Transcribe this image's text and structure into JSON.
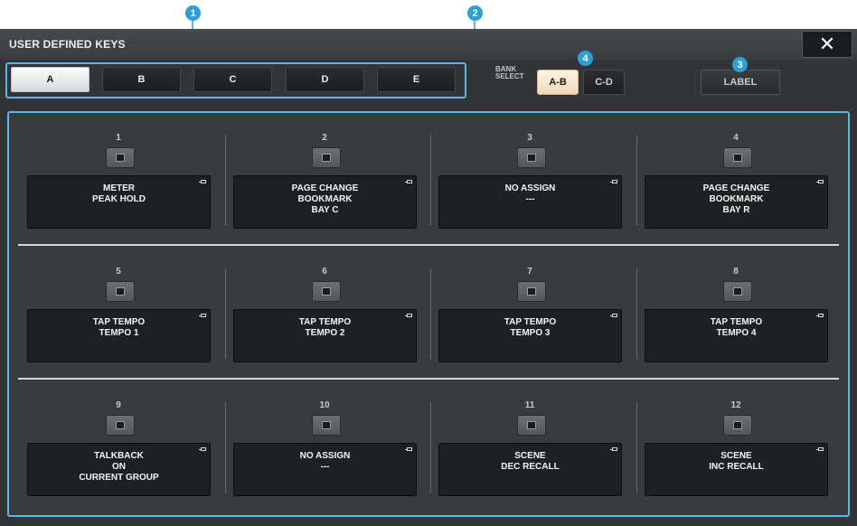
{
  "window": {
    "title": "USER DEFINED KEYS",
    "close_label": "✕"
  },
  "tabs": [
    {
      "label": "A",
      "active": true
    },
    {
      "label": "B",
      "active": false
    },
    {
      "label": "C",
      "active": false
    },
    {
      "label": "D",
      "active": false
    },
    {
      "label": "E",
      "active": false
    }
  ],
  "bank_select": {
    "label_line1": "BANK",
    "label_line2": "SELECT",
    "options": [
      {
        "label": "A-B",
        "active": true
      },
      {
        "label": "C-D",
        "active": false
      }
    ]
  },
  "label_button": "LABEL",
  "callouts": [
    "1",
    "2",
    "3",
    "4"
  ],
  "keys": [
    {
      "number": "1",
      "assignment": "METER\nPEAK HOLD"
    },
    {
      "number": "2",
      "assignment": "PAGE CHANGE\nBOOKMARK\nBAY C"
    },
    {
      "number": "3",
      "assignment": "NO ASSIGN\n---"
    },
    {
      "number": "4",
      "assignment": "PAGE CHANGE\nBOOKMARK\nBAY R"
    },
    {
      "number": "5",
      "assignment": "TAP TEMPO\nTEMPO 1"
    },
    {
      "number": "6",
      "assignment": "TAP TEMPO\nTEMPO 2"
    },
    {
      "number": "7",
      "assignment": "TAP TEMPO\nTEMPO 3"
    },
    {
      "number": "8",
      "assignment": "TAP TEMPO\nTEMPO 4"
    },
    {
      "number": "9",
      "assignment": "TALKBACK\nON\nCURRENT GROUP"
    },
    {
      "number": "10",
      "assignment": "NO ASSIGN\n---"
    },
    {
      "number": "11",
      "assignment": "SCENE\nDEC RECALL"
    },
    {
      "number": "12",
      "assignment": "SCENE\nINC RECALL"
    }
  ],
  "colors": {
    "callout": "#2c9fd8",
    "highlight_border": "#55b8e6",
    "tab_active": "#f0f0f0",
    "bank_active": "#f6e2c8"
  }
}
